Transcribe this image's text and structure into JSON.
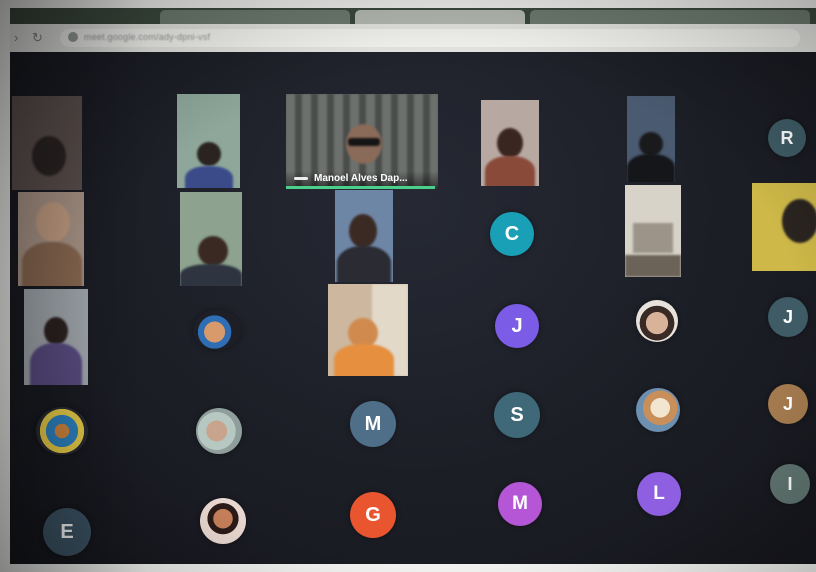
{
  "browser": {
    "tabs": [
      "",
      "",
      ""
    ],
    "url": "meet.google.com/ady-dpni-vsf"
  },
  "meeting": {
    "active_speaker_name": "Manoel Alves Dap..."
  },
  "letter_avatars": [
    {
      "id": "r1",
      "letter": "R",
      "color": "#3f5c66"
    },
    {
      "id": "c1",
      "letter": "C",
      "color": "#1aa0b6"
    },
    {
      "id": "j1",
      "letter": "J",
      "color": "#7b5ce6"
    },
    {
      "id": "j2",
      "letter": "J",
      "color": "#3f5c66"
    },
    {
      "id": "m1",
      "letter": "M",
      "color": "#4f6f88"
    },
    {
      "id": "s1",
      "letter": "S",
      "color": "#3f6878"
    },
    {
      "id": "j3",
      "letter": "J",
      "color": "#a37a4e"
    },
    {
      "id": "e1",
      "letter": "E",
      "color": "#3d5566"
    },
    {
      "id": "g1",
      "letter": "G",
      "color": "#e8552f"
    },
    {
      "id": "m2",
      "letter": "M",
      "color": "#b456d6"
    },
    {
      "id": "l1",
      "letter": "L",
      "color": "#8e5fe0"
    },
    {
      "id": "i1",
      "letter": "I",
      "color": "#5f7470"
    }
  ]
}
